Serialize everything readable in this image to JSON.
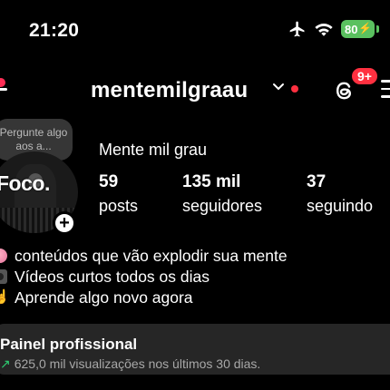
{
  "status_bar": {
    "time": "21:20",
    "battery": "80"
  },
  "header": {
    "username": "mentemilgraau",
    "threads_badge": "9+"
  },
  "note": {
    "text": "Pergunte algo aos a..."
  },
  "avatar": {
    "text": "Foco."
  },
  "profile": {
    "display_name": "Mente mil grau",
    "stats": {
      "posts": {
        "value": "59",
        "label": "posts"
      },
      "followers": {
        "value": "135 mil",
        "label": "seguidores"
      },
      "following": {
        "value": "37",
        "label": "seguindo"
      }
    },
    "bio": [
      {
        "icon": "brain-emoji-icon",
        "text": "conteúdos que vão explodir sua mente"
      },
      {
        "icon": "camera-emoji-icon",
        "text": "Vídeos curtos todos os dias"
      },
      {
        "icon": "pointing-up-emoji-icon",
        "text": "Aprende algo novo agora"
      }
    ]
  },
  "professional_panel": {
    "title": "Painel profissional",
    "arrow": "↗",
    "subtitle": "625,0 mil visualizações nos últimos 30 dias."
  },
  "colors": {
    "background": "#000000",
    "accent_red": "#ff3040",
    "battery_green": "#5ac15f",
    "panel_bg": "#262626",
    "trend_green": "#2ecc71"
  }
}
